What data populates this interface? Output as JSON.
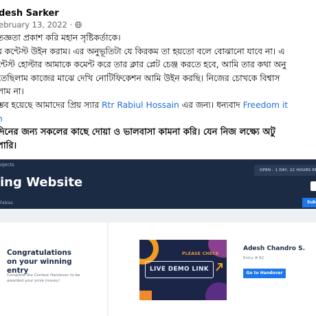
{
  "post": {
    "author": "desh Sarker",
    "date_text": "ebruary 13, 2022 · ",
    "globe_icon": "globe-icon",
    "lines": [
      "তজ্ঞতা প্রকাশ করি মহান সৃষ্টিকর্তাকে।",
      "ম কন্টেস্ট উইন করাম। এর অনুভূতিটা যে কিরকম তা হয়তো বলে বোঝানো যাবে না। এ",
      "ন্টেস্ট হোল্টার আমাকে কমেন্ট করে তার ক্লার প্লেট চেঞ্জ করতে হবে, আমি তার কথা অনু",
      "তেছিলাম কাজের মাঝে দেখি নোটিফিকেশন আমি উইন করছি। নিজের চোখকে বিশ্বাস",
      "লাম না।"
    ],
    "thanks_prefix": "ম্ভব হয়েছে আমাদের প্রিয় স্যার ",
    "thanks_link1": "Rtr Rabiul Hossain",
    "thanks_mid": " এর জন্য। ধন্যবাদ ",
    "thanks_link2": "Freedom it",
    "thanks_link2_cont": "n",
    "prayer_lines": [
      "দিনের জন্য সকলের কাছে দোয়া ও ভালবাসা কামনা করি। যেন নিজ লক্ষ্যে অটু",
      "পারি।"
    ]
  },
  "shared_screenshot": {
    "breadcrumb": "ojects",
    "project_title": "ing Website",
    "owner": "Fabias",
    "status_text": "OPEN - 1 DAY, 22 HOURS RE",
    "submit_label": "Sub",
    "congrats_title": "Congratulations on your winning entry",
    "congrats_sub": "Complete the Contest Handover to be awarded your prize money!",
    "thumb_please": "PLEASE CHECK",
    "thumb_demo": "LIVE DEMO LINK",
    "entrant_name": "Adesh Chandro S.",
    "entry_no": "Entry # 82",
    "handover_label": "Go to Handover",
    "colors": {
      "banner": "#1b2b44",
      "accent": "#1e77e8",
      "thumb_orange": "#f39c22"
    }
  }
}
